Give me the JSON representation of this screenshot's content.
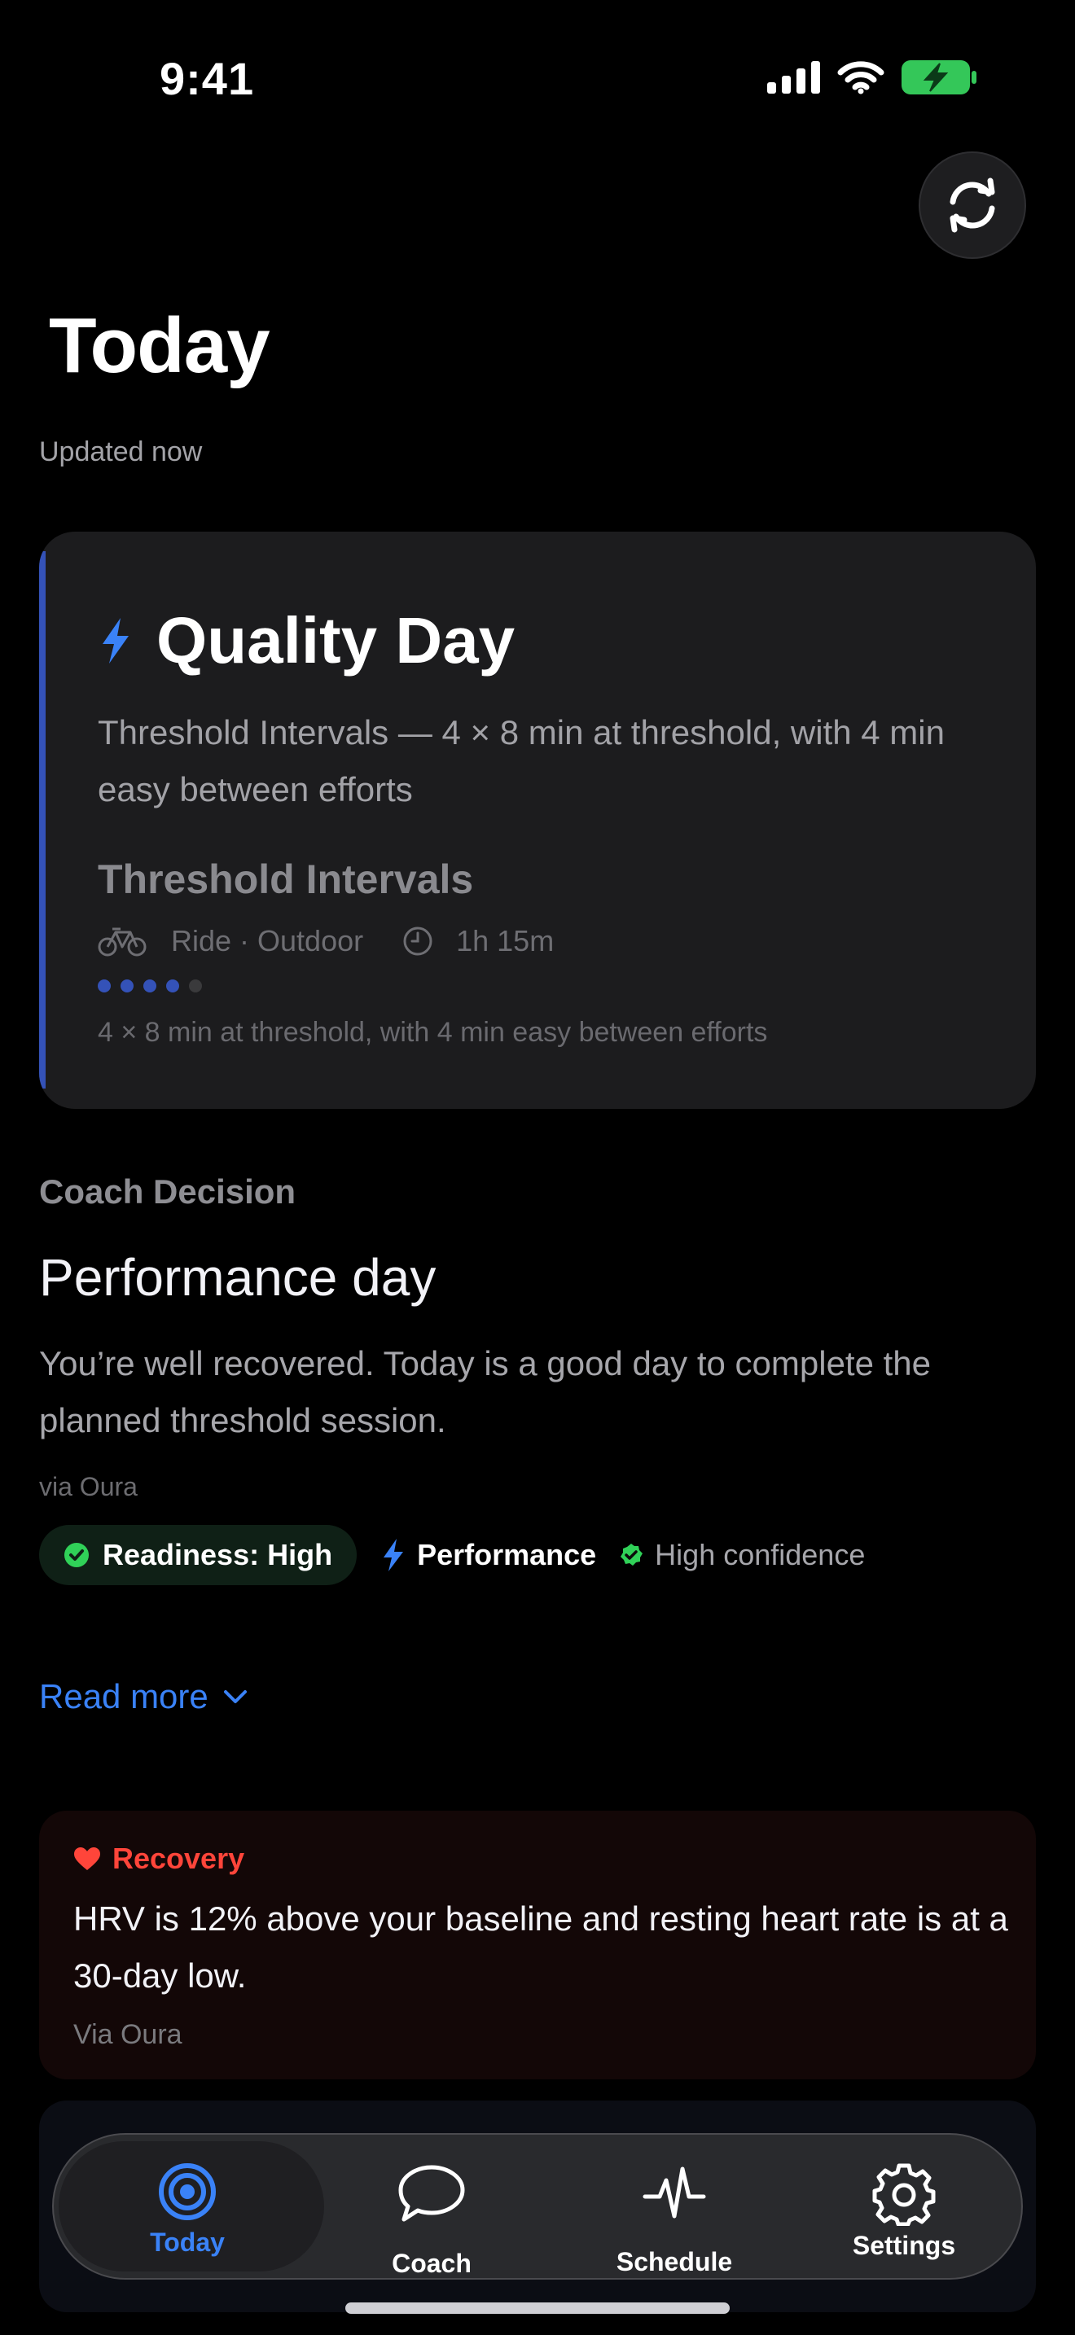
{
  "status_bar": {
    "time": "9:41",
    "battery_color": "#34c759"
  },
  "header": {
    "title": "Today",
    "updated": "Updated now",
    "refresh_icon": "refresh-icon"
  },
  "plan_card": {
    "title": "Quality Day",
    "icon": "bolt-icon",
    "description": "Threshold Intervals — 4 × 8 min at threshold, with 4 min easy between efforts",
    "workout": {
      "name": "Threshold Intervals",
      "sport": "Ride · Outdoor",
      "duration": "1h 15m",
      "intensity_level": 4,
      "intensity_max": 5,
      "detail": "4 × 8 min at threshold, with 4 min easy between efforts"
    },
    "accent_color": "#3452b8"
  },
  "coach_decision": {
    "section_label": "Coach Decision",
    "title": "Performance day",
    "text": "You’re well recovered. Today is a good day to complete the planned threshold session.",
    "source": "via Oura",
    "chips": {
      "readiness": "Readiness: High",
      "performance": "Performance",
      "confidence": "High confidence"
    },
    "read_more": "Read more"
  },
  "recovery_card": {
    "label": "Recovery",
    "text": "HRV is 12% above your baseline and resting heart rate is at a 30-day low.",
    "source": "Via Oura",
    "accent_color": "#ff453a"
  },
  "tab_bar": {
    "tabs": [
      {
        "label": "Today",
        "icon": "target-icon",
        "active": true
      },
      {
        "label": "Coach",
        "icon": "chat-bubble-icon"
      },
      {
        "label": "Schedule",
        "icon": "pulse-icon"
      },
      {
        "label": "Settings",
        "icon": "gear-icon"
      }
    ],
    "active_color": "#3a82f7"
  }
}
